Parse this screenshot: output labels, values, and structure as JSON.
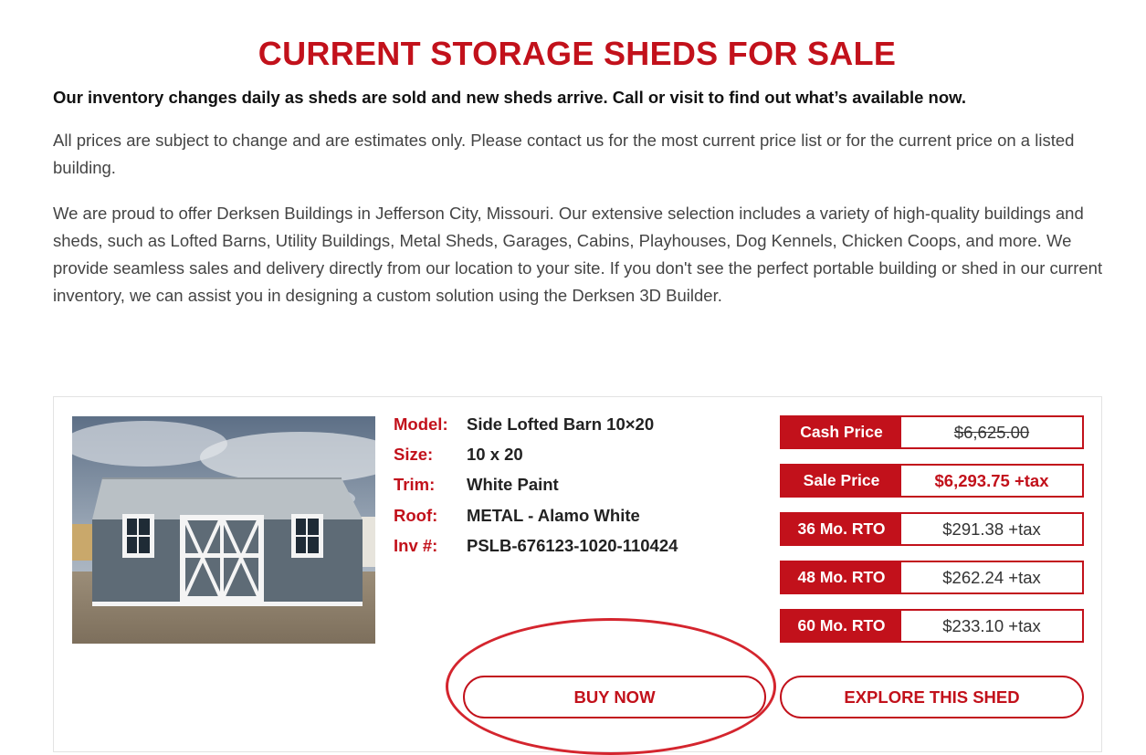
{
  "page": {
    "title": "CURRENT STORAGE SHEDS FOR SALE",
    "subtitle": "Our inventory changes daily as sheds are sold and new sheds arrive. Call or visit to find out what’s available now.",
    "paragraph1": "All prices are subject to change and are estimates only. Please contact us for the most current price list or for the current price on a listed building.",
    "paragraph2": "We are proud to offer Derksen Buildings in Jefferson City, Missouri. Our extensive selection includes a variety of high-quality buildings and sheds, such as Lofted Barns, Utility Buildings, Metal Sheds, Garages, Cabins, Playhouses, Dog Kennels, Chicken Coops, and more. We provide seamless sales and delivery directly from our location to your site. If you don't see the perfect portable building or shed in our current inventory, we can assist you in designing a custom solution using the Derksen 3D Builder."
  },
  "listing": {
    "specs": [
      {
        "label": "Model:",
        "value": "Side Lofted Barn 10×20"
      },
      {
        "label": "Size:",
        "value": "10 x 20"
      },
      {
        "label": "Trim:",
        "value": "White Paint"
      },
      {
        "label": "Roof:",
        "value": "METAL - Alamo White"
      },
      {
        "label": "Inv #:",
        "value": "PSLB-676123-1020-110424"
      }
    ],
    "prices": [
      {
        "label": "Cash Price",
        "value": "$6,625.00"
      },
      {
        "label": "Sale Price",
        "value": "$6,293.75 +tax"
      },
      {
        "label": "36 Mo. RTO",
        "value": "$291.38 +tax"
      },
      {
        "label": "48 Mo. RTO",
        "value": "$262.24 +tax"
      },
      {
        "label": "60 Mo. RTO",
        "value": "$233.10 +tax"
      }
    ],
    "buy_button": "BUY NOW",
    "explore_button": "EXPLORE THIS SHED"
  },
  "colors": {
    "accent": "#c2111b",
    "shed_siding": "#5e6b76",
    "roof": "#b9c0c5",
    "trim": "#f4f4f4"
  }
}
